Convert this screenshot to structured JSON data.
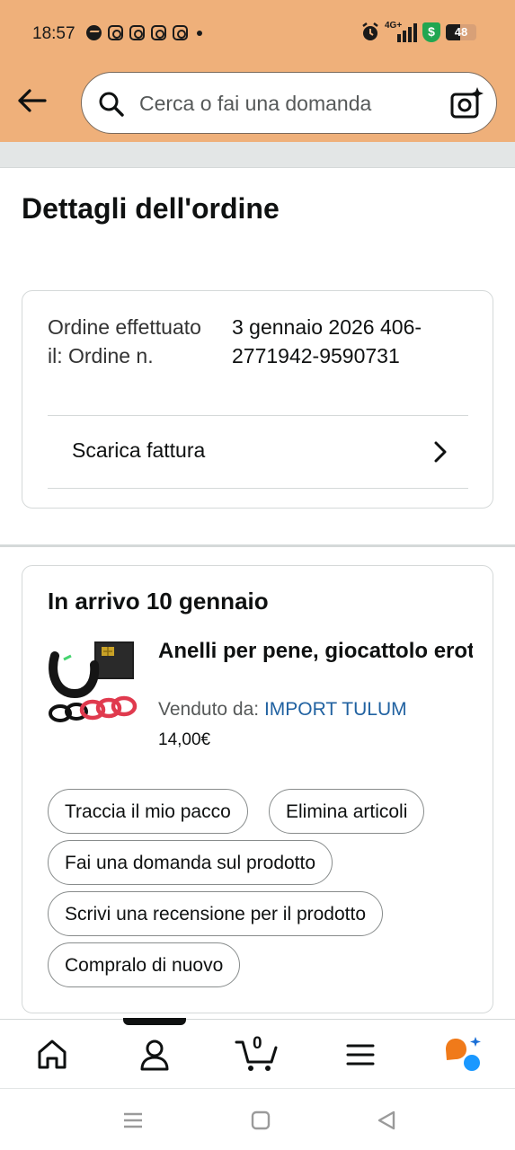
{
  "status_bar": {
    "time": "18:57",
    "network": "4G+",
    "battery_text": "48",
    "battery_level": 0.48,
    "shield_symbol": "$"
  },
  "header": {
    "search_placeholder": "Cerca o fai una domanda",
    "back_icon": "arrow-left-icon",
    "camera_icon": "camera-sparkle-icon",
    "background_color": "#efb07a"
  },
  "page": {
    "title": "Dettagli dell'ordine"
  },
  "order_info": {
    "label": "Ordine effettuato il: Ordine n.",
    "value": "3 gennaio 2026 406-2771942-9590731",
    "invoice_label": "Scarica fattura"
  },
  "shipment": {
    "arrival": "In arrivo 10 gennaio",
    "product_title": "Anelli per pene, giocattolo erotico, anelli per pene, m...",
    "seller_prefix": "Venduto da: ",
    "seller_name": "IMPORT TULUM",
    "price": "14,00€",
    "actions": {
      "track": "Traccia il mio pacco",
      "delete": "Elimina articoli",
      "ask": "Fai una domanda sul prodotto",
      "review": "Scrivi una recensione per il prodotto",
      "rebuy": "Compralo di nuovo"
    },
    "link_color": "#2162a1"
  },
  "bottom_nav": {
    "cart_count": "0",
    "items": [
      "home-icon",
      "account-icon",
      "cart-icon",
      "menu-icon",
      "rufus-assistant-icon"
    ]
  }
}
